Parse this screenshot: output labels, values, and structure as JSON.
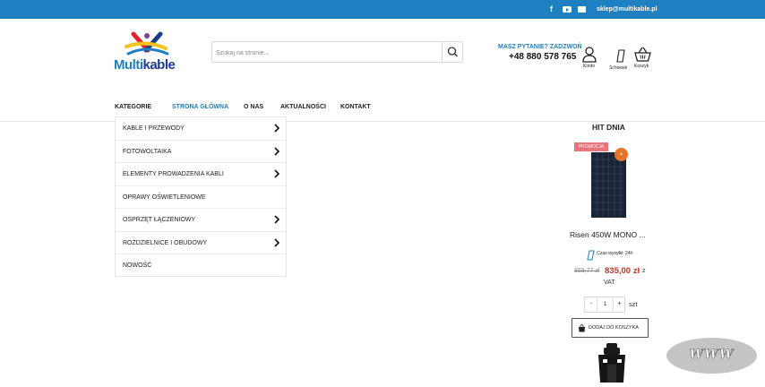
{
  "topbar": {
    "social_facebook_icon": "facebook-icon",
    "social_youtube_icon": "youtube-icon",
    "mail_icon": "envelope-icon",
    "email": "sklep@multikable.pl"
  },
  "brand": {
    "logo_text_1": "Multi",
    "logo_text_2": "kable",
    "colors": {
      "primary": "#1e7fc1",
      "dark": "#1e3a8a",
      "accent_red": "#e5232d",
      "accent_yellow": "#f6c11a"
    }
  },
  "search": {
    "placeholder": "Szukaj na stronie...",
    "button_icon": "search-icon"
  },
  "contact": {
    "question": "MASZ PYTANIE? ZADZWOŃ",
    "phone": "+48 880 578 765"
  },
  "header_icons": [
    {
      "icon": "user-icon",
      "label": "Konto"
    },
    {
      "icon": "phone-icon",
      "label": "Schowek"
    },
    {
      "icon": "basket-icon",
      "label": "Koszyk"
    }
  ],
  "nav": {
    "categories": " KATEGORIE",
    "items": [
      "STRONA GŁÓWNA",
      "O NAS",
      "AKTUALNOŚCI",
      "KONTAKT"
    ],
    "active": "STRONA GŁÓWNA"
  },
  "category_menu": [
    {
      "label": "KABLE I PRZEWODY",
      "has_submenu": true
    },
    {
      "label": "FOTOWOLTAIKA",
      "has_submenu": true
    },
    {
      "label": "ELEMENTY PROWADZENIA KABLI",
      "has_submenu": true
    },
    {
      "label": "OPRAWY OŚWIETLENIOWE",
      "has_submenu": false
    },
    {
      "label": "OSPRZĘT ŁĄCZENIOWY",
      "has_submenu": true
    },
    {
      "label": "ROZDZIELNICE I OBUDOWY",
      "has_submenu": true
    },
    {
      "label": "NOWOŚĆ",
      "has_submenu": false
    }
  ],
  "hit_dnia": {
    "title": "HIT DNIA",
    "promo_badge": "PROMOCJA",
    "product_name": "Risen 450W MONO ...",
    "shipping": "Czas wysyłki: 24h",
    "old_price": "859,77 zł",
    "new_price": "835,00 zł",
    "price_suffix_1": "z",
    "price_suffix_2": "VAT",
    "quantity": "1",
    "minus": "-",
    "plus": "+",
    "unit": "szt",
    "add_to_cart": "DODAJ DO KOSZYKA"
  },
  "watermark": {
    "text": "WWW"
  }
}
